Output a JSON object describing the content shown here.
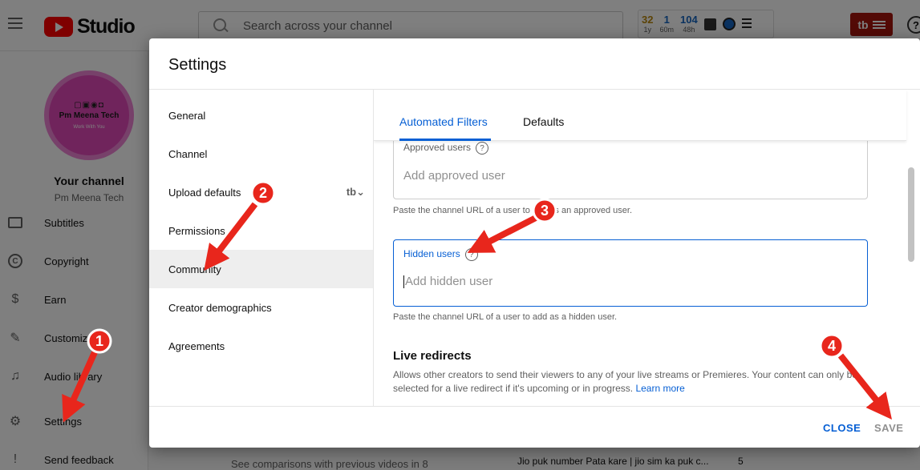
{
  "app": {
    "logo_text": "Studio",
    "search_placeholder": "Search across your channel",
    "stats": [
      {
        "value": "32",
        "label": "1y",
        "color": "#b8860b"
      },
      {
        "value": "1",
        "label": "60m",
        "color": "#1565c0"
      },
      {
        "value": "104",
        "label": "48h",
        "color": "#1565c0"
      }
    ],
    "tb_label": "tb",
    "help_glyph": "?"
  },
  "sidebar": {
    "avatar_title": "Pm Meena Tech",
    "avatar_sub": "Work With You",
    "your_channel": "Your channel",
    "channel_name": "Pm Meena Tech",
    "items": [
      {
        "label": "Subtitles",
        "icon": "subtitles-icon"
      },
      {
        "label": "Copyright",
        "icon": "copyright-icon",
        "glyph": "C"
      },
      {
        "label": "Earn",
        "icon": "dollar-icon",
        "glyph": "$"
      },
      {
        "label": "Customization",
        "icon": "magic-wand-icon",
        "glyph": "✎"
      },
      {
        "label": "Audio library",
        "icon": "audio-library-icon",
        "glyph": "♫"
      },
      {
        "label": "Settings",
        "icon": "gear-icon",
        "glyph": "⚙"
      },
      {
        "label": "Send feedback",
        "icon": "feedback-icon",
        "glyph": "!"
      }
    ]
  },
  "background": {
    "text_1": "See comparisons with previous videos in 8",
    "text_2": "Jio puk number Pata kare | jio sim ka puk c...",
    "text_3": "5"
  },
  "dialog": {
    "title": "Settings",
    "nav": [
      {
        "label": "General"
      },
      {
        "label": "Channel"
      },
      {
        "label": "Upload defaults"
      },
      {
        "label": "Permissions"
      },
      {
        "label": "Community",
        "active": true
      },
      {
        "label": "Creator demographics"
      },
      {
        "label": "Agreements"
      }
    ],
    "tb_glyph": "tb⌄",
    "tabs": [
      {
        "label": "Automated Filters",
        "active": true
      },
      {
        "label": "Defaults"
      }
    ],
    "approved_users": {
      "label": "Approved users",
      "placeholder": "Add approved user",
      "helper": "Paste the channel URL of a user to add as an approved user."
    },
    "hidden_users": {
      "label": "Hidden users",
      "placeholder": "Add hidden user",
      "helper": "Paste the channel URL of a user to add as a hidden user."
    },
    "live_redirects": {
      "title": "Live redirects",
      "description": "Allows other creators to send their viewers to any of your live streams or Premieres. Your content can only be selected for a live redirect if it's upcoming or in progress.",
      "link": "Learn more"
    },
    "close_label": "CLOSE",
    "save_label": "SAVE"
  },
  "annotations": {
    "badges": [
      "1",
      "2",
      "3",
      "4"
    ],
    "color": "#e8261c"
  }
}
